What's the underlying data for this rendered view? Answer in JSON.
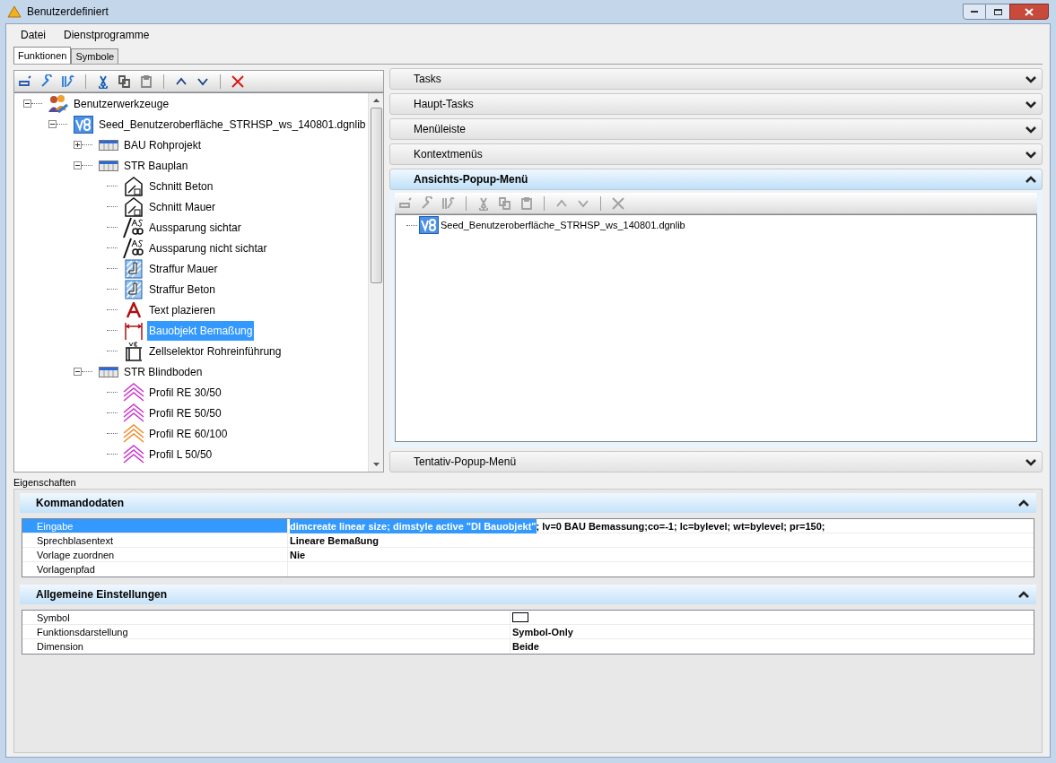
{
  "window": {
    "title": "Benutzerdefiniert"
  },
  "menu": [
    "Datei",
    "Dienstprogramme"
  ],
  "tabs": [
    {
      "label": "Funktionen",
      "selected": true
    },
    {
      "label": "Symbole",
      "selected": false
    }
  ],
  "tree": [
    {
      "label": "Benutzerwerkzeuge",
      "kind": "toolbox",
      "expanded": true,
      "selected": false,
      "children": [
        {
          "label": "Seed_Benutzeroberfläche_STRHSP_ws_140801.dgnlib",
          "kind": "library",
          "expanded": true,
          "selected": false,
          "children": [
            {
              "label": "BAU Rohprojekt",
              "kind": "group",
              "expanded": false,
              "selected": false
            },
            {
              "label": "STR Bauplan",
              "kind": "group",
              "expanded": true,
              "selected": false,
              "children": [
                {
                  "label": "Schnitt Beton",
                  "kind": "section",
                  "selected": false
                },
                {
                  "label": "Schnitt Mauer",
                  "kind": "section",
                  "selected": false
                },
                {
                  "label": "Aussparung sichtar",
                  "kind": "opening",
                  "selected": false
                },
                {
                  "label": "Aussparung nicht sichtar",
                  "kind": "opening",
                  "selected": false
                },
                {
                  "label": "Straffur Mauer",
                  "kind": "hatch",
                  "selected": false
                },
                {
                  "label": "Straffur Beton",
                  "kind": "hatch",
                  "selected": false
                },
                {
                  "label": "Text plazieren",
                  "kind": "text",
                  "selected": false
                },
                {
                  "label": "Bauobjekt Bemaßung",
                  "kind": "dimension",
                  "selected": true
                },
                {
                  "label": "Zellselektor Rohreinführung",
                  "kind": "cell",
                  "selected": false
                }
              ]
            },
            {
              "label": "STR Blindboden",
              "kind": "group",
              "expanded": true,
              "selected": false,
              "children": [
                {
                  "label": "Profil RE 30/50",
                  "kind": "profile",
                  "color": "#cc33cc",
                  "selected": false
                },
                {
                  "label": "Profil RE 50/50",
                  "kind": "profile",
                  "color": "#cc33cc",
                  "selected": false
                },
                {
                  "label": "Profil RE 60/100",
                  "kind": "profile",
                  "color": "#f08a24",
                  "selected": false
                },
                {
                  "label": "Profil L 50/50",
                  "kind": "profile",
                  "color": "#cc33cc",
                  "selected": false
                }
              ]
            }
          ]
        }
      ]
    }
  ],
  "sections": [
    {
      "title": "Tasks",
      "expanded": false
    },
    {
      "title": "Haupt-Tasks",
      "expanded": false
    },
    {
      "title": "Menüleiste",
      "expanded": false
    },
    {
      "title": "Kontextmenüs",
      "expanded": false
    },
    {
      "title": "Ansichts-Popup-Menü",
      "expanded": true,
      "toolbar_disabled": true,
      "tree": [
        {
          "label": "Seed_Benutzeroberfläche_STRHSP_ws_140801.dgnlib"
        }
      ]
    },
    {
      "title": "Tentativ-Popup-Menü",
      "expanded": false
    }
  ],
  "properties": {
    "title": "Eigenschaften",
    "groups": [
      {
        "title": "Kommandodaten",
        "expanded": true,
        "rows": [
          {
            "label": "Eingabe",
            "selected": true,
            "value_highlighted": "dimcreate linear size; dimstyle active \"DI Bauobjekt\"",
            "value": "; lv=0 BAU Bemassung;co=-1; lc=bylevel; wt=bylevel; pr=150;"
          },
          {
            "label": "Sprechblasentext",
            "selected": false,
            "value": "Lineare Bemaßung"
          },
          {
            "label": "Vorlage zuordnen",
            "selected": false,
            "value": "Nie"
          },
          {
            "label": "Vorlagenpfad",
            "selected": false
          }
        ]
      },
      {
        "title": "Allgemeine Einstellungen",
        "expanded": true,
        "rows": [
          {
            "label": "Symbol",
            "selected": false,
            "kind": "symbol"
          },
          {
            "label": "Funktionsdarstellung",
            "selected": false,
            "value": "Symbol-Only"
          },
          {
            "label": "Dimension",
            "selected": false,
            "value": "Beide"
          }
        ]
      }
    ]
  }
}
